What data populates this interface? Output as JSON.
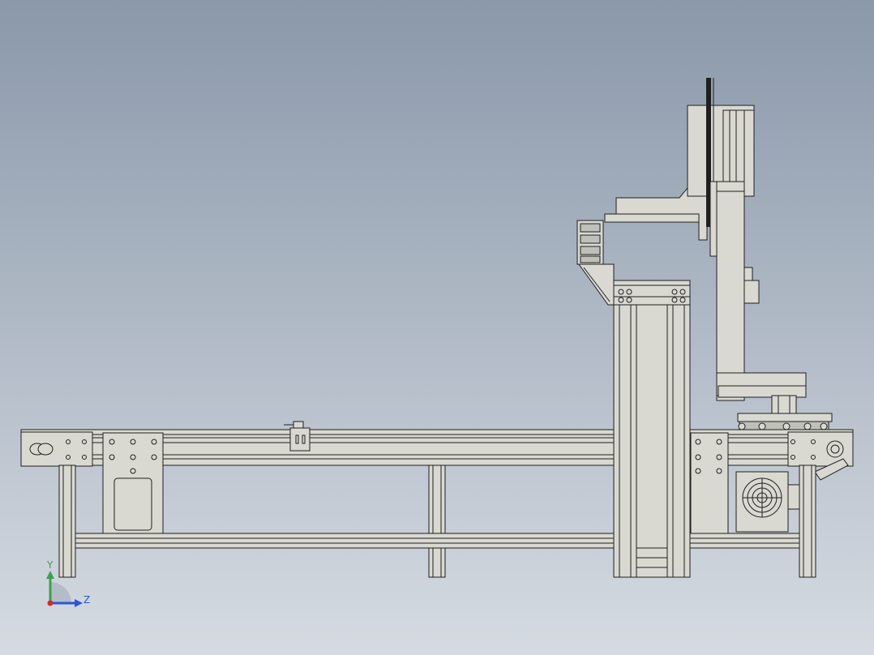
{
  "viewport": {
    "background_top": "#8a98aa",
    "background_bottom": "#d6dbe2"
  },
  "model": {
    "part_fill": "#d9d9d2",
    "part_fill_dark": "#bfc0b8",
    "edge_color": "#1f1f1f"
  },
  "triad": {
    "y_label": "Y",
    "z_label": "Z",
    "y_color": "#3aa24a",
    "z_color": "#2a57d8",
    "x_color": "#d42a2a"
  }
}
